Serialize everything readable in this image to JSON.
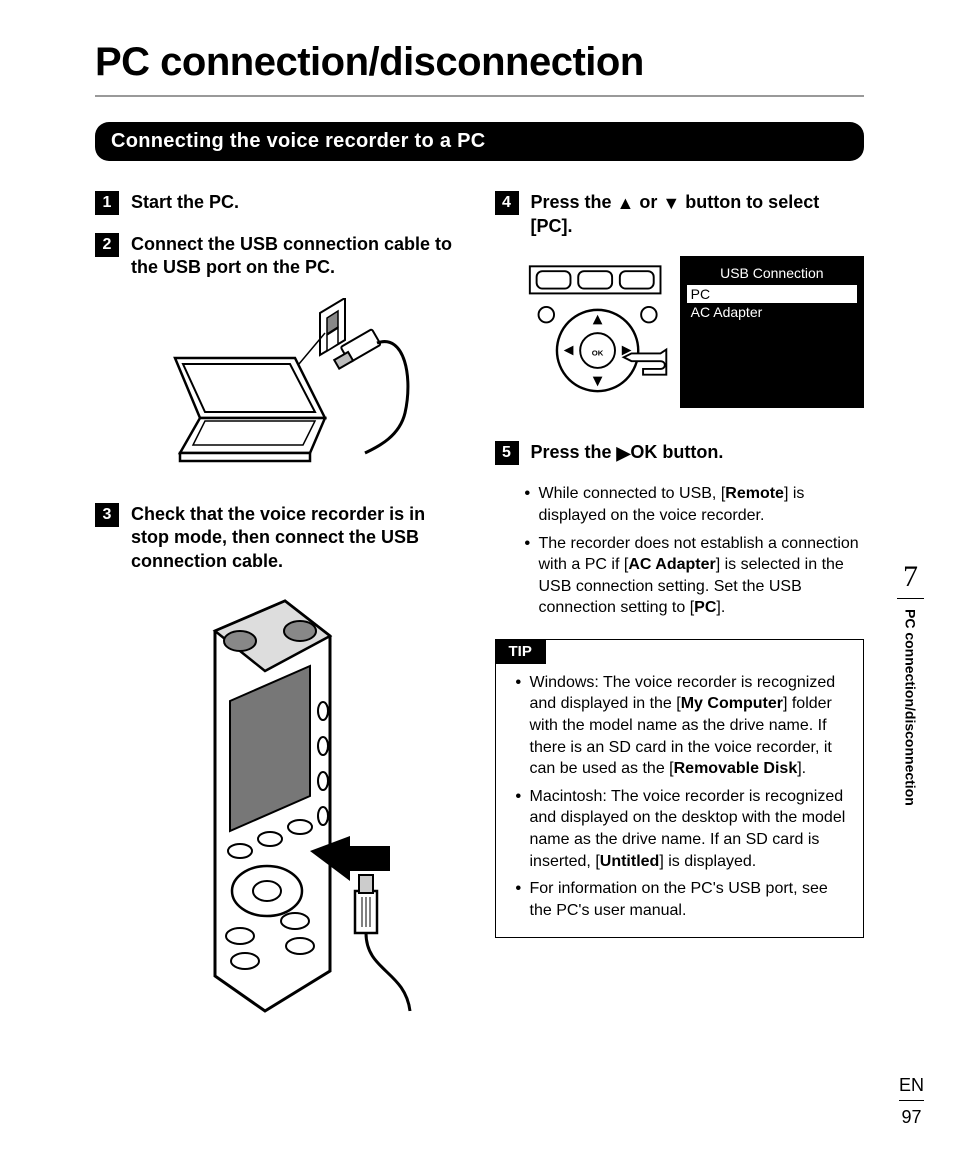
{
  "title": "PC connection/disconnection",
  "section_header": "Connecting the voice recorder to a PC",
  "steps": {
    "s1": {
      "num": "1",
      "text": "Start the PC."
    },
    "s2": {
      "num": "2",
      "text": "Connect the USB connection cable to the USB port on the PC."
    },
    "s3": {
      "num": "3",
      "text": "Check that the voice recorder is in stop mode, then connect the USB connection cable."
    },
    "s4": {
      "num": "4",
      "pre": "Press the ",
      "mid": " or ",
      "post": " button to select [",
      "pc": "PC",
      "end": "]."
    },
    "s5": {
      "num": "5",
      "pre": "Press the ",
      "ok": "OK",
      "post": " button."
    }
  },
  "screen": {
    "title": "USB Connection",
    "item1": "PC",
    "item2": "AC Adapter"
  },
  "notes": {
    "n1a": "While connected to USB, [",
    "n1b": "Remote",
    "n1c": "] is displayed on the voice recorder.",
    "n2a": "The recorder does not establish a connection with a PC if [",
    "n2b": "AC Adapter",
    "n2c": "] is selected in the USB connection setting. Set the USB connection setting to [",
    "n2d": "PC",
    "n2e": "]."
  },
  "tip": {
    "label": "TIP",
    "t1a": "Windows: The voice recorder is recognized and displayed in the [",
    "t1b": "My Computer",
    "t1c": "] folder with the model name as the drive name. If there is an SD card in the voice recorder, it can be used as the [",
    "t1d": "Removable Disk",
    "t1e": "].",
    "t2a": "Macintosh: The voice recorder is recognized and displayed on the desktop with the model name as the drive name. If an SD card is inserted, [",
    "t2b": "Untitled",
    "t2c": "] is displayed.",
    "t3": "For information on the PC's USB port, see the PC's user manual."
  },
  "side": {
    "chapter": "7",
    "label": "PC connection/disconnection"
  },
  "footer": {
    "lang": "EN",
    "page": "97"
  }
}
